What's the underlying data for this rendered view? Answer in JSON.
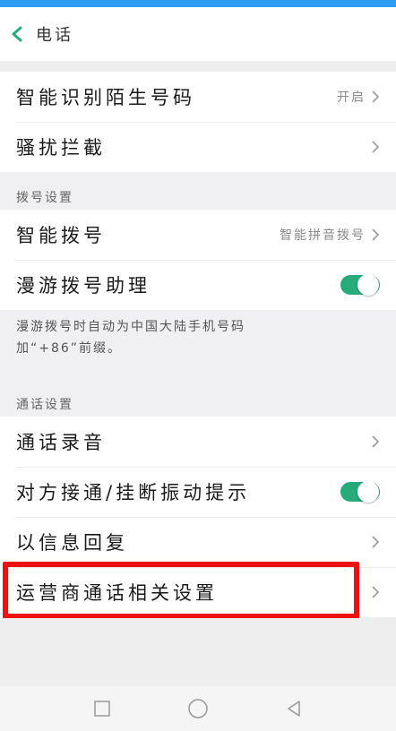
{
  "header": {
    "title": "电话"
  },
  "group1": {
    "items": [
      {
        "label": "智能识别陌生号码",
        "value": "开启"
      },
      {
        "label": "骚扰拦截",
        "value": ""
      }
    ]
  },
  "dial_settings": {
    "section_title": "拨号设置",
    "items": [
      {
        "label": "智能拨号",
        "value": "智能拼音拨号"
      },
      {
        "label": "漫游拨号助理",
        "toggle": "on"
      }
    ],
    "description_line1": "漫游拨号时自动为中国大陆手机号码",
    "description_line2": "加“+86”前缀。"
  },
  "call_settings": {
    "section_title": "通话设置",
    "items": [
      {
        "label": "通话录音"
      },
      {
        "label": "对方接通/挂断振动提示",
        "toggle": "on"
      },
      {
        "label": "以信息回复"
      },
      {
        "label": "运营商通话相关设置"
      }
    ]
  },
  "colors": {
    "accent": "#27ab7a",
    "highlight": "#ee1111",
    "status_bar": "#2f9df3"
  },
  "navbar": {
    "icons": [
      "square-recent-icon",
      "circle-home-icon",
      "triangle-back-icon"
    ]
  }
}
